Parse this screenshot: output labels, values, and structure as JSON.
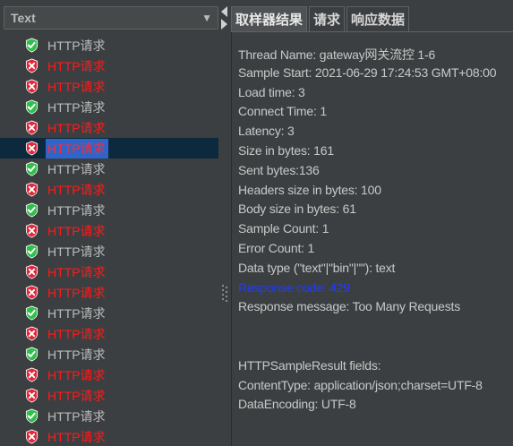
{
  "left_panel": {
    "combo": {
      "selected": "Text",
      "arrow": "▼"
    },
    "samples": [
      {
        "label": "HTTP请求",
        "status": "ok"
      },
      {
        "label": "HTTP请求",
        "status": "error"
      },
      {
        "label": "HTTP请求",
        "status": "error"
      },
      {
        "label": "HTTP请求",
        "status": "ok"
      },
      {
        "label": "HTTP请求",
        "status": "error"
      },
      {
        "label": "HTTP请求",
        "status": "error",
        "selected": true
      },
      {
        "label": "HTTP请求",
        "status": "ok"
      },
      {
        "label": "HTTP请求",
        "status": "error"
      },
      {
        "label": "HTTP请求",
        "status": "ok"
      },
      {
        "label": "HTTP请求",
        "status": "error"
      },
      {
        "label": "HTTP请求",
        "status": "ok"
      },
      {
        "label": "HTTP请求",
        "status": "error"
      },
      {
        "label": "HTTP请求",
        "status": "error"
      },
      {
        "label": "HTTP请求",
        "status": "ok"
      },
      {
        "label": "HTTP请求",
        "status": "error"
      },
      {
        "label": "HTTP请求",
        "status": "ok"
      },
      {
        "label": "HTTP请求",
        "status": "error"
      },
      {
        "label": "HTTP请求",
        "status": "error"
      },
      {
        "label": "HTTP请求",
        "status": "ok"
      },
      {
        "label": "HTTP请求",
        "status": "error"
      }
    ],
    "colors": {
      "ok_icon": "#2fbf4a",
      "error_icon": "#e0283b",
      "error_text": "#ff1a1a",
      "selection": "#2f65ca"
    }
  },
  "tabs": [
    {
      "label": "取样器结果",
      "active": true
    },
    {
      "label": "请求",
      "active": false
    },
    {
      "label": "响应数据",
      "active": false
    }
  ],
  "result_lines": [
    {
      "text": "Thread Name: gateway网关流控 1-6"
    },
    {
      "text": "Sample Start: 2021-06-29 17:24:53 GMT+08:00"
    },
    {
      "text": "Load time: 3"
    },
    {
      "text": "Connect Time: 1"
    },
    {
      "text": "Latency: 3"
    },
    {
      "text": "Size in bytes: 161"
    },
    {
      "text": "Sent bytes:136"
    },
    {
      "text": "Headers size in bytes: 100"
    },
    {
      "text": "Body size in bytes: 61"
    },
    {
      "text": "Sample Count: 1"
    },
    {
      "text": "Error Count: 1"
    },
    {
      "text": "Data type (\"text\"|\"bin\"|\"\"): text"
    },
    {
      "text": "Response code: 429",
      "highlight": true
    },
    {
      "text": "Response message: Too Many Requests"
    },
    {
      "text": ""
    },
    {
      "text": ""
    },
    {
      "text": "HTTPSampleResult fields:"
    },
    {
      "text": "ContentType: application/json;charset=UTF-8"
    },
    {
      "text": "DataEncoding: UTF-8"
    }
  ]
}
